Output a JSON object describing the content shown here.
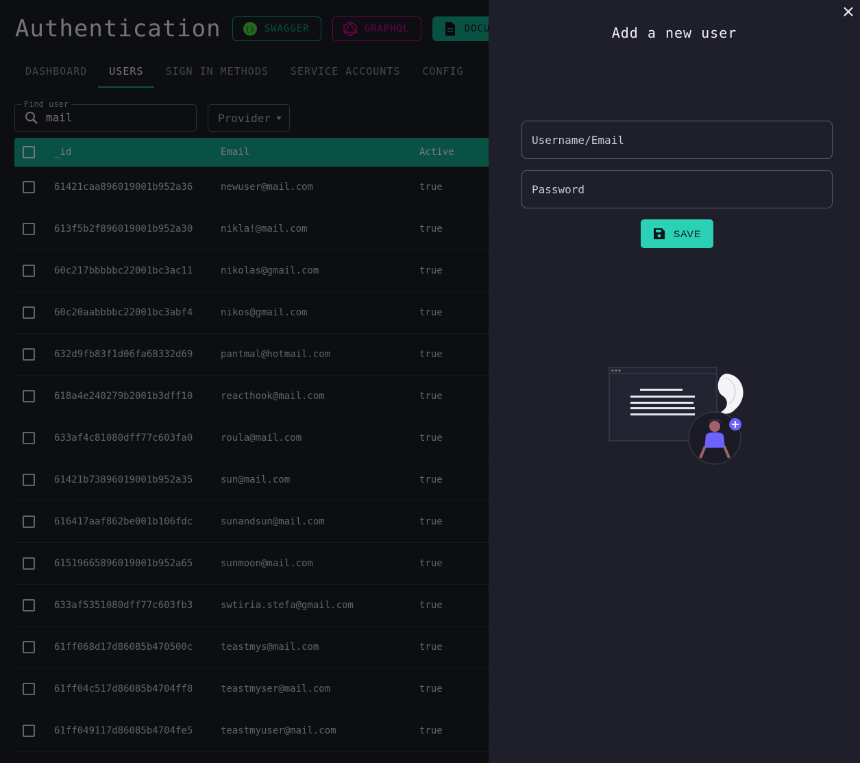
{
  "page": {
    "title": "Authentication",
    "header_buttons": [
      {
        "label": "SWAGGER",
        "icon": "swagger-icon"
      },
      {
        "label": "GRAPHQL",
        "icon": "graphql-icon"
      },
      {
        "label": "DOCUMENTATION",
        "icon": "document-icon"
      }
    ],
    "tabs": [
      "DASHBOARD",
      "USERS",
      "SIGN IN METHODS",
      "SERVICE ACCOUNTS",
      "CONFIG"
    ],
    "active_tab": "USERS",
    "search": {
      "label": "Find user",
      "value": "mail"
    },
    "provider": {
      "label": "Provider"
    },
    "columns": [
      "_id",
      "Email",
      "Active"
    ],
    "users": [
      {
        "id": "61421caa896019001b952a36",
        "email": "newuser@mail.com",
        "active": "true"
      },
      {
        "id": "613f5b2f896019001b952a30",
        "email": "nikla!@mail.com",
        "active": "true"
      },
      {
        "id": "60c217bbbbbc22001bc3ac11",
        "email": "nikolas@gmail.com",
        "active": "true"
      },
      {
        "id": "60c20aabbbbc22001bc3abf4",
        "email": "nikos@gmail.com",
        "active": "true"
      },
      {
        "id": "632d9fb83f1d06fa68332d69",
        "email": "pantmal@hotmail.com",
        "active": "true"
      },
      {
        "id": "618a4e240279b2001b3dff10",
        "email": "reacthook@mail.com",
        "active": "true"
      },
      {
        "id": "633af4c81080dff77c603fa0",
        "email": "roula@mail.com",
        "active": "true"
      },
      {
        "id": "61421b73896019001b952a35",
        "email": "sun@mail.com",
        "active": "true"
      },
      {
        "id": "616417aaf862be001b106fdc",
        "email": "sunandsun@mail.com",
        "active": "true"
      },
      {
        "id": "61519665896019001b952a65",
        "email": "sunmoon@mail.com",
        "active": "true"
      },
      {
        "id": "633af5351080dff77c603fb3",
        "email": "swtiria.stefa@gmail.com",
        "active": "true"
      },
      {
        "id": "61ff068d17d86085b470500c",
        "email": "teastmys@mail.com",
        "active": "true"
      },
      {
        "id": "61ff04c517d86085b4704ff8",
        "email": "teastmyser@mail.com",
        "active": "true"
      },
      {
        "id": "61ff049117d86085b4704fe5",
        "email": "teastmyuser@mail.com",
        "active": "true"
      }
    ]
  },
  "drawer": {
    "title": "Add a new user",
    "username_placeholder": "Username/Email",
    "password_placeholder": "Password",
    "save_label": "SAVE"
  },
  "colors": {
    "accent": "#12a487",
    "save_button": "#2bd1b4",
    "drawer_bg": "#1f1f2b",
    "illustration_purple": "#6c63ff"
  }
}
